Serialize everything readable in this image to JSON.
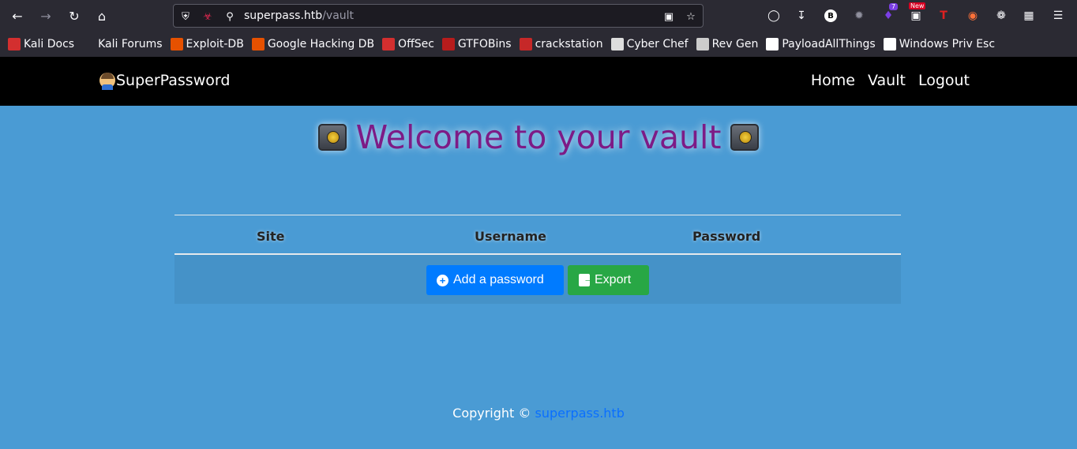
{
  "browser": {
    "url_host": "superpass.htb",
    "url_path": "/vault",
    "badges": {
      "extension_count": "7",
      "new_label": "New"
    }
  },
  "bookmarks": [
    {
      "label": "Kali Docs",
      "icon": "kali-docs-icon",
      "color": "#d32f2f"
    },
    {
      "label": "Kali Forums",
      "icon": "kali-dragon-icon",
      "color": "#2b2a33"
    },
    {
      "label": "Exploit-DB",
      "icon": "exploit-db-icon",
      "color": "#e65100"
    },
    {
      "label": "Google Hacking DB",
      "icon": "ghdb-icon",
      "color": "#e65100"
    },
    {
      "label": "OffSec",
      "icon": "offsec-icon",
      "color": "#d32f2f"
    },
    {
      "label": "GTFOBins",
      "icon": "gtfobins-icon",
      "color": "#b71c1c"
    },
    {
      "label": "crackstation",
      "icon": "crackstation-icon",
      "color": "#c62828"
    },
    {
      "label": "Cyber Chef",
      "icon": "chef-hat-icon",
      "color": "#dddddd"
    },
    {
      "label": "Rev Gen",
      "icon": "skull-icon",
      "color": "#cccccc"
    },
    {
      "label": "PayloadAllThings",
      "icon": "github-icon",
      "color": "#ffffff"
    },
    {
      "label": "Windows Priv Esc",
      "icon": "book-icon",
      "color": "#ffffff"
    }
  ],
  "site": {
    "brand": "SuperPassword",
    "nav": [
      "Home",
      "Vault",
      "Logout"
    ]
  },
  "main": {
    "heading": "Welcome to your vault",
    "columns": [
      "Site",
      "Username",
      "Password"
    ],
    "add_label": "Add a password",
    "export_label": "Export"
  },
  "footer": {
    "text": "Copyright © ",
    "link": "superpass.htb"
  },
  "colors": {
    "page_bg": "#4a9bd4",
    "heading": "#7d1b86",
    "add_button": "#007bff",
    "export_button": "#28a745"
  }
}
